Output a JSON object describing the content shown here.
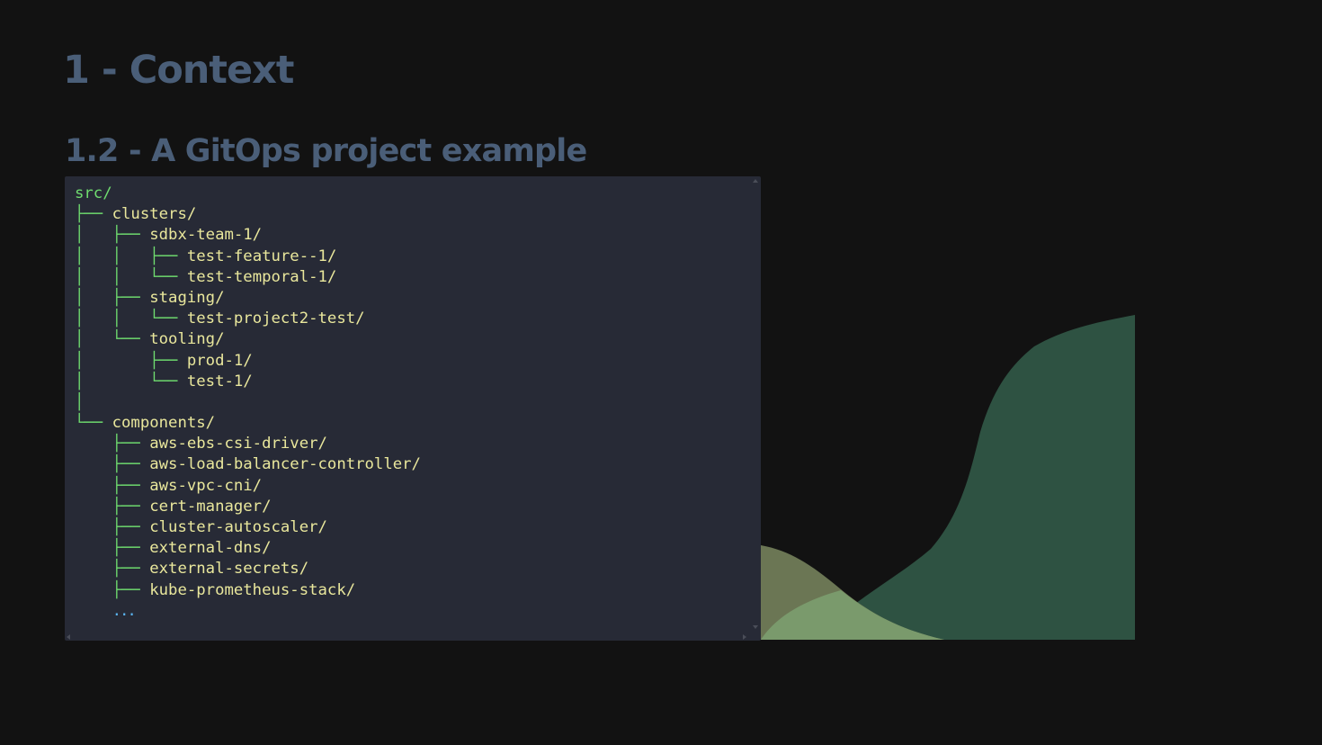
{
  "slide": {
    "title": "1 - Context",
    "subtitle": "1.2 - A GitOps project example"
  },
  "code": {
    "lines": [
      {
        "branch": "",
        "name": "src/",
        "root": true
      },
      {
        "branch": "├── ",
        "name": "clusters/"
      },
      {
        "branch": "│   ├── ",
        "name": "sdbx-team-1/"
      },
      {
        "branch": "│   │   ├── ",
        "name": "test-feature--1/"
      },
      {
        "branch": "│   │   └── ",
        "name": "test-temporal-1/"
      },
      {
        "branch": "│   ├── ",
        "name": "staging/"
      },
      {
        "branch": "│   │   └── ",
        "name": "test-project2-test/"
      },
      {
        "branch": "│   └── ",
        "name": "tooling/"
      },
      {
        "branch": "│       ├── ",
        "name": "prod-1/"
      },
      {
        "branch": "│       └── ",
        "name": "test-1/"
      },
      {
        "branch": "│",
        "name": ""
      },
      {
        "branch": "└── ",
        "name": "components/"
      },
      {
        "branch": "    ├── ",
        "name": "aws-ebs-csi-driver/"
      },
      {
        "branch": "    ├── ",
        "name": "aws-load-balancer-controller/"
      },
      {
        "branch": "    ├── ",
        "name": "aws-vpc-cni/"
      },
      {
        "branch": "    ├── ",
        "name": "cert-manager/"
      },
      {
        "branch": "    ├── ",
        "name": "cluster-autoscaler/"
      },
      {
        "branch": "    ├── ",
        "name": "external-dns/"
      },
      {
        "branch": "    ├── ",
        "name": "external-secrets/"
      },
      {
        "branch": "    ├── ",
        "name": "kube-prometheus-stack/"
      },
      {
        "branch": "    ",
        "name": "...",
        "more": true
      }
    ]
  },
  "colors": {
    "background": "#121212",
    "heading": "#4a5e78",
    "panel": "#272a36",
    "tree_branch": "#6fdc6f",
    "tree_name": "#e9e79c",
    "ellipsis": "#5ab4f0",
    "wave_dark": "#2e5242",
    "wave_olive": "#6b7654",
    "wave_light": "#7a9a6c"
  }
}
